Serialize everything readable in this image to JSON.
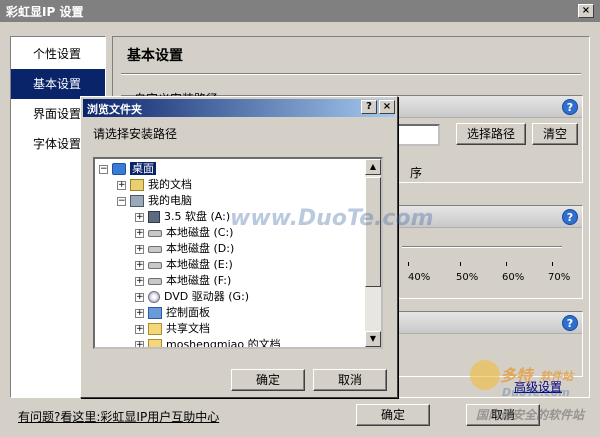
{
  "main": {
    "title": "彩虹显IP 设置",
    "close_glyph": "×"
  },
  "sidebar": {
    "items": [
      {
        "label": "个性设置"
      },
      {
        "label": "基本设置"
      },
      {
        "label": "界面设置"
      },
      {
        "label": "字体设置"
      }
    ]
  },
  "content": {
    "title": "基本设置",
    "install_path_label": "自定义安装路径",
    "choose_path_button": "选择路径",
    "clear_button": "清空",
    "partial_text_program": "序",
    "slider_ticks": [
      "40%",
      "50%",
      "60%",
      "70%"
    ],
    "advanced_link": "高级设置"
  },
  "dialog": {
    "title": "浏览文件夹",
    "help_glyph": "?",
    "close_glyph": "×",
    "prompt": "请选择安装路径",
    "tree": [
      {
        "label": "桌面",
        "icon": "desktop-icon",
        "expander": "−",
        "selected": true
      },
      {
        "label": "我的文档",
        "icon": "documents-icon",
        "expander": "+"
      },
      {
        "label": "我的电脑",
        "icon": "computer-icon",
        "expander": "−"
      },
      {
        "label": "3.5 软盘 (A:)",
        "icon": "floppy-icon",
        "expander": "+"
      },
      {
        "label": "本地磁盘 (C:)",
        "icon": "disk-icon",
        "expander": "+"
      },
      {
        "label": "本地磁盘 (D:)",
        "icon": "disk-icon",
        "expander": "+"
      },
      {
        "label": "本地磁盘 (E:)",
        "icon": "disk-icon",
        "expander": "+"
      },
      {
        "label": "本地磁盘 (F:)",
        "icon": "disk-icon",
        "expander": "+"
      },
      {
        "label": "DVD 驱动器 (G:)",
        "icon": "dvd-icon",
        "expander": "+"
      },
      {
        "label": "控制面板",
        "icon": "control-panel-icon",
        "expander": "+"
      },
      {
        "label": "共享文档",
        "icon": "folder-icon",
        "expander": "+"
      },
      {
        "label": "moshengmiao 的文档",
        "icon": "folder-icon",
        "expander": "+"
      }
    ],
    "ok_button": "确定",
    "cancel_button": "取消"
  },
  "footer": {
    "help_link": "有问题?看这里:彩虹显IP用户互助中心",
    "ok_button": "确定",
    "cancel_button": "取消"
  },
  "watermarks": {
    "center": "www.DuoTe.com",
    "brand": "多特",
    "brand_small": "软件站",
    "url": "DuoTe.com",
    "tagline": "国内最安全的软件站"
  }
}
